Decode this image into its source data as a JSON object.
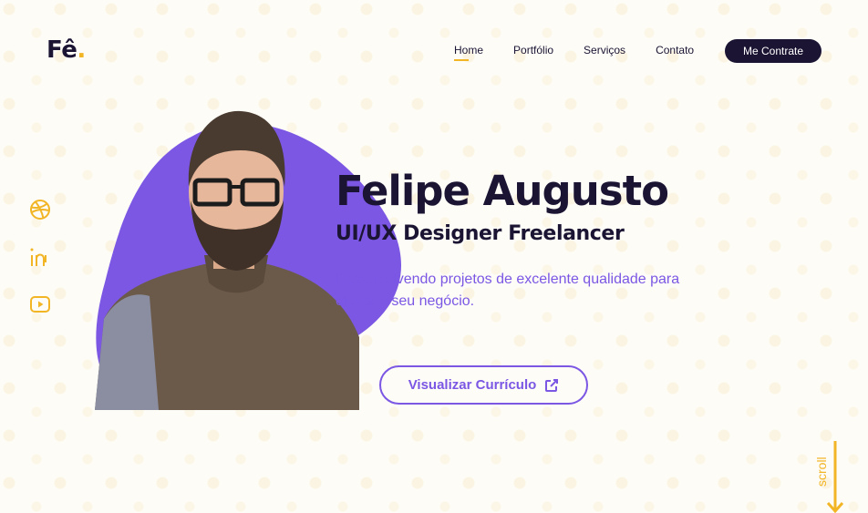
{
  "logo": {
    "text": "Fê",
    "dot": "."
  },
  "nav": {
    "items": [
      {
        "label": "Home",
        "active": true
      },
      {
        "label": "Portfólio",
        "active": false
      },
      {
        "label": "Serviços",
        "active": false
      },
      {
        "label": "Contato",
        "active": false
      }
    ],
    "cta_label": "Me Contrate"
  },
  "social": [
    {
      "icon": "dribbble-icon"
    },
    {
      "icon": "linkedin-icon"
    },
    {
      "icon": "youtube-icon"
    }
  ],
  "hero": {
    "name": "Felipe Augusto",
    "role": "UI/UX Designer Freelancer",
    "description": "Desenvolvendo projetos de excelente qualidade para elevar o seu negócio.",
    "button_label": "Visualizar Currículo",
    "button_icon": "external-link-icon",
    "photo_alt": "Felipe Augusto"
  },
  "scroll": {
    "label": "scroll",
    "icon": "arrow-down-icon"
  },
  "colors": {
    "accent": "#7b57e4",
    "dark": "#1c1433",
    "yellow": "#f2b526",
    "background": "#fdfcf7"
  }
}
